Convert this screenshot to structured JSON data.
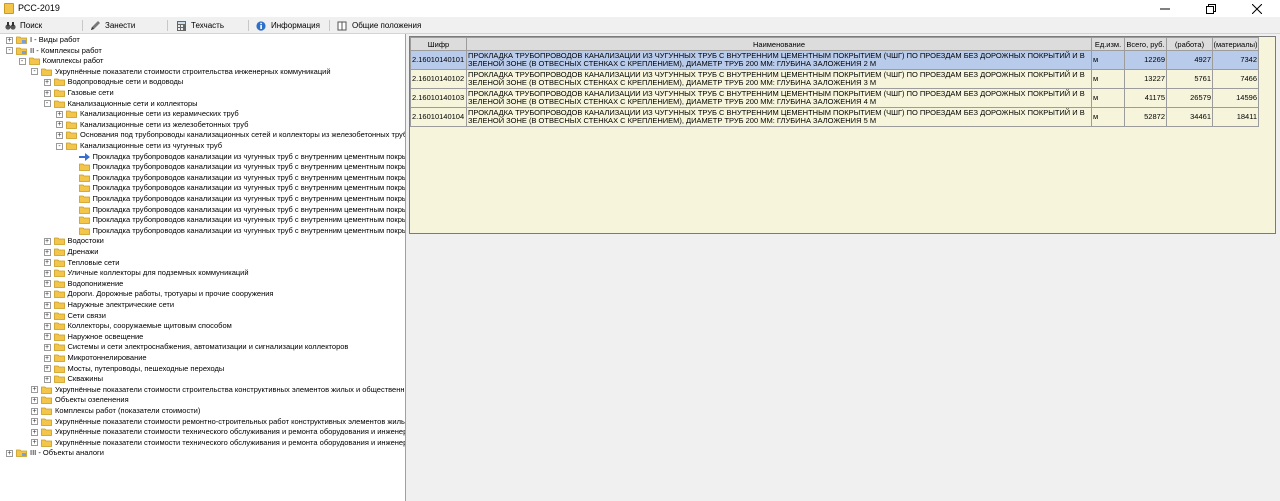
{
  "window": {
    "title": "РСС-2019"
  },
  "toolbar": {
    "items": [
      {
        "label": "Поиск",
        "icon": "binoculars-icon"
      },
      {
        "label": "Занести",
        "icon": "pencil-icon"
      },
      {
        "label": "Техчасть",
        "icon": "calculator-icon"
      },
      {
        "label": "Информация",
        "icon": "info-icon"
      },
      {
        "label": "Общие положения",
        "icon": "book-icon"
      }
    ]
  },
  "tree": {
    "nodes": [
      {
        "label": "I - Виды работ",
        "level": 0,
        "expander": "+",
        "icon": "folder-tree"
      },
      {
        "label": "II - Комплексы работ",
        "level": 0,
        "expander": "-",
        "icon": "folder-tree"
      },
      {
        "label": "Комплексы работ",
        "level": 1,
        "expander": "-",
        "icon": "folder"
      },
      {
        "label": "Укрупнённые показатели стоимости строительства инженерных коммуникаций",
        "level": 2,
        "expander": "-",
        "icon": "folder"
      },
      {
        "label": "Водопроводные сети и водоводы",
        "level": 3,
        "expander": "+",
        "icon": "folder"
      },
      {
        "label": "Газовые сети",
        "level": 3,
        "expander": "+",
        "icon": "folder"
      },
      {
        "label": "Канализационные сети и коллекторы",
        "level": 3,
        "expander": "-",
        "icon": "folder"
      },
      {
        "label": "Канализационные сети из керамических труб",
        "level": 4,
        "expander": "+",
        "icon": "folder"
      },
      {
        "label": "Канализационные сети из железобетонных труб",
        "level": 4,
        "expander": "+",
        "icon": "folder"
      },
      {
        "label": "Основания под трубопроводы канализационных сетей и коллекторы из железобетонных труб",
        "level": 4,
        "expander": "+",
        "icon": "folder"
      },
      {
        "label": "Канализационные сети из чугунных труб",
        "level": 4,
        "expander": "-",
        "icon": "folder"
      },
      {
        "label": "Прокладка трубопроводов канализации из чугунных труб с внутренним цементным покрыти",
        "level": 5,
        "expander": "",
        "icon": "arrow"
      },
      {
        "label": "Прокладка трубопроводов канализации из чугунных труб с внутренним цементным покрыти",
        "level": 5,
        "expander": "",
        "icon": "folder"
      },
      {
        "label": "Прокладка трубопроводов канализации из чугунных труб с внутренним цементным покрыти",
        "level": 5,
        "expander": "",
        "icon": "folder"
      },
      {
        "label": "Прокладка трубопроводов канализации из чугунных труб с внутренним цементным покрыти",
        "level": 5,
        "expander": "",
        "icon": "folder"
      },
      {
        "label": "Прокладка трубопроводов канализации из чугунных труб с внутренним цементным покрыти",
        "level": 5,
        "expander": "",
        "icon": "folder"
      },
      {
        "label": "Прокладка трубопроводов канализации из чугунных труб с внутренним цементным покрыти",
        "level": 5,
        "expander": "",
        "icon": "folder"
      },
      {
        "label": "Прокладка трубопроводов канализации из чугунных труб с внутренним цементным покрыти",
        "level": 5,
        "expander": "",
        "icon": "folder"
      },
      {
        "label": "Прокладка трубопроводов канализации из чугунных труб с внутренним цементным покрыти",
        "level": 5,
        "expander": "",
        "icon": "folder"
      },
      {
        "label": "Водостоки",
        "level": 3,
        "expander": "+",
        "icon": "folder"
      },
      {
        "label": "Дренажи",
        "level": 3,
        "expander": "+",
        "icon": "folder"
      },
      {
        "label": "Тепловые сети",
        "level": 3,
        "expander": "+",
        "icon": "folder"
      },
      {
        "label": "Уличные коллекторы для подземных коммуникаций",
        "level": 3,
        "expander": "+",
        "icon": "folder"
      },
      {
        "label": "Водопонижение",
        "level": 3,
        "expander": "+",
        "icon": "folder"
      },
      {
        "label": "Дороги. Дорожные работы, тротуары и прочие сооружения",
        "level": 3,
        "expander": "+",
        "icon": "folder"
      },
      {
        "label": "Наружные электрические сети",
        "level": 3,
        "expander": "+",
        "icon": "folder"
      },
      {
        "label": "Сети связи",
        "level": 3,
        "expander": "+",
        "icon": "folder"
      },
      {
        "label": "Коллекторы, сооружаемые щитовым способом",
        "level": 3,
        "expander": "+",
        "icon": "folder"
      },
      {
        "label": "Наружное освещение",
        "level": 3,
        "expander": "+",
        "icon": "folder"
      },
      {
        "label": "Системы и сети электроснабжения, автоматизации и сигнализации коллекторов",
        "level": 3,
        "expander": "+",
        "icon": "folder"
      },
      {
        "label": "Микротоннелирование",
        "level": 3,
        "expander": "+",
        "icon": "folder"
      },
      {
        "label": "Мосты, путепроводы, пешеходные переходы",
        "level": 3,
        "expander": "+",
        "icon": "folder"
      },
      {
        "label": "Скважины",
        "level": 3,
        "expander": "+",
        "icon": "folder"
      },
      {
        "label": "Укрупнённые показатели стоимости строительства конструктивных элементов жилых и общественн",
        "level": 2,
        "expander": "+",
        "icon": "folder"
      },
      {
        "label": "Объекты озеленения",
        "level": 2,
        "expander": "+",
        "icon": "folder"
      },
      {
        "label": "Комплексы работ (показатели стоимости)",
        "level": 2,
        "expander": "+",
        "icon": "folder"
      },
      {
        "label": "Укрупнённые показатели стоимости ремонтно-строительных работ конструктивных элементов жилых",
        "level": 2,
        "expander": "+",
        "icon": "folder"
      },
      {
        "label": "Укрупнённые показатели стоимости технического обслуживания и ремонта оборудования и инженерн",
        "level": 2,
        "expander": "+",
        "icon": "folder"
      },
      {
        "label": "Укрупнённые показатели стоимости технического обслуживания и ремонта оборудования и инженерн",
        "level": 2,
        "expander": "+",
        "icon": "folder"
      },
      {
        "label": "III - Объекты аналоги",
        "level": 0,
        "expander": "+",
        "icon": "folder-tree"
      }
    ]
  },
  "grid": {
    "headers": [
      "Шифр",
      "Наименование",
      "Ед.изм.",
      "Всего, руб.",
      "(работа)",
      "(материалы)"
    ],
    "rows": [
      {
        "code": "2.16010140101",
        "name": "ПРОКЛАДКА ТРУБОПРОВОДОВ КАНАЛИЗАЦИИ ИЗ ЧУГУННЫХ ТРУБ С ВНУТРЕННИМ ЦЕМЕНТНЫМ ПОКРЫТИЕМ (ЧШГ) ПО ПРОЕЗДАМ БЕЗ ДОРОЖНЫХ ПОКРЫТИЙ И В ЗЕЛЕНОЙ ЗОНЕ (В ОТВЕСНЫХ СТЕНКАХ С КРЕПЛЕНИЕМ), ДИАМЕТР ТРУБ 200 ММ: ГЛУБИНА ЗАЛОЖЕНИЯ 2 М",
        "unit": "м",
        "total": "12269",
        "work": "4927",
        "materials": "7342"
      },
      {
        "code": "2.16010140102",
        "name": "ПРОКЛАДКА ТРУБОПРОВОДОВ КАНАЛИЗАЦИИ ИЗ ЧУГУННЫХ ТРУБ С ВНУТРЕННИМ ЦЕМЕНТНЫМ ПОКРЫТИЕМ (ЧШГ) ПО ПРОЕЗДАМ БЕЗ ДОРОЖНЫХ ПОКРЫТИЙ И В ЗЕЛЕНОЙ ЗОНЕ (В ОТВЕСНЫХ СТЕНКАХ С КРЕПЛЕНИЕМ), ДИАМЕТР ТРУБ 200 ММ: ГЛУБИНА ЗАЛОЖЕНИЯ 3 М",
        "unit": "м",
        "total": "13227",
        "work": "5761",
        "materials": "7466"
      },
      {
        "code": "2.16010140103",
        "name": "ПРОКЛАДКА ТРУБОПРОВОДОВ КАНАЛИЗАЦИИ ИЗ ЧУГУННЫХ ТРУБ С ВНУТРЕННИМ ЦЕМЕНТНЫМ ПОКРЫТИЕМ (ЧШГ) ПО ПРОЕЗДАМ БЕЗ ДОРОЖНЫХ ПОКРЫТИЙ И В ЗЕЛЕНОЙ ЗОНЕ (В ОТВЕСНЫХ СТЕНКАХ С КРЕПЛЕНИЕМ), ДИАМЕТР ТРУБ 200 ММ: ГЛУБИНА ЗАЛОЖЕНИЯ 4 М",
        "unit": "м",
        "total": "41175",
        "work": "26579",
        "materials": "14596"
      },
      {
        "code": "2.16010140104",
        "name": "ПРОКЛАДКА ТРУБОПРОВОДОВ КАНАЛИЗАЦИИ ИЗ ЧУГУННЫХ ТРУБ С ВНУТРЕННИМ ЦЕМЕНТНЫМ ПОКРЫТИЕМ (ЧШГ) ПО ПРОЕЗДАМ БЕЗ ДОРОЖНЫХ ПОКРЫТИЙ И В ЗЕЛЕНОЙ ЗОНЕ (В ОТВЕСНЫХ СТЕНКАХ С КРЕПЛЕНИЕМ), ДИАМЕТР ТРУБ 200 ММ: ГЛУБИНА ЗАЛОЖЕНИЯ 5 М",
        "unit": "м",
        "total": "52872",
        "work": "34461",
        "materials": "18411"
      }
    ]
  },
  "colors": {
    "grid_bg": "#f6f5dc",
    "selected_row": "#b9cbea",
    "folder": "#f3c64b",
    "arrow": "#3a6fd0"
  }
}
